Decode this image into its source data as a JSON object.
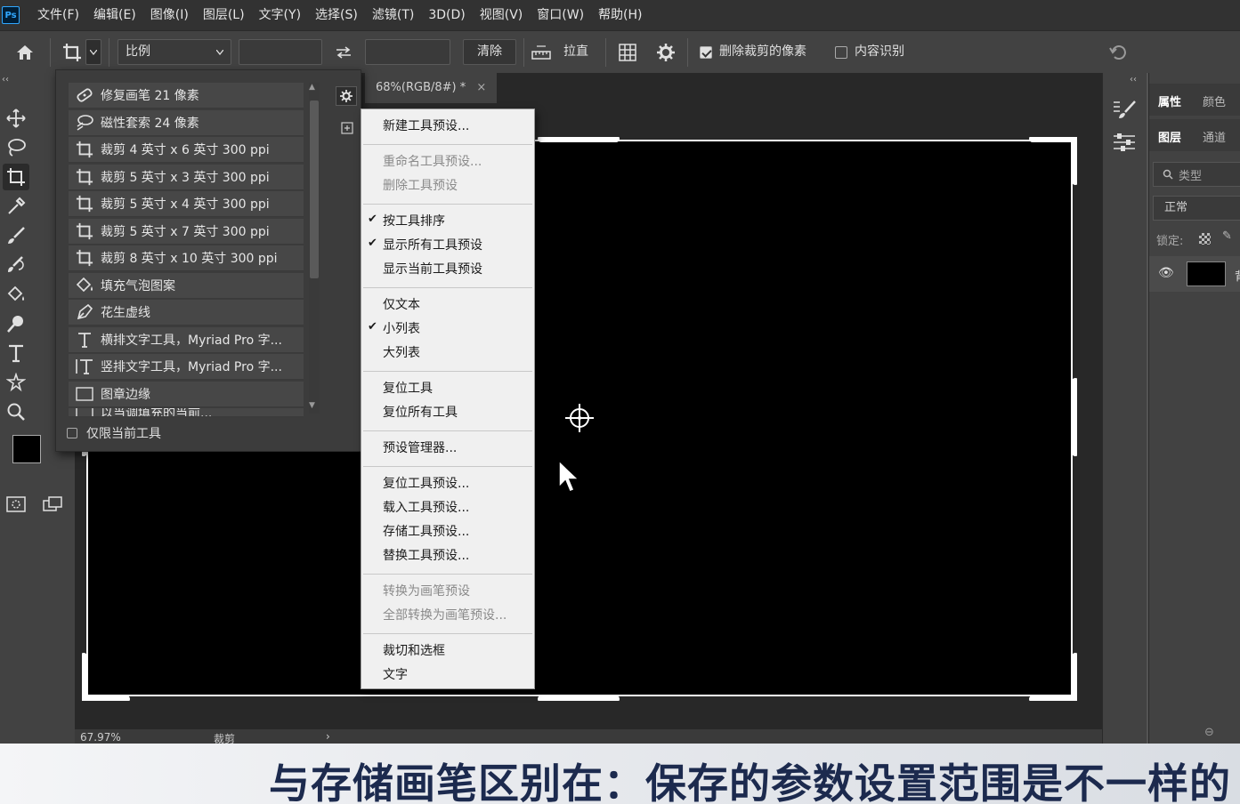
{
  "menubar": {
    "logo": "Ps",
    "items": [
      "文件(F)",
      "编辑(E)",
      "图像(I)",
      "图层(L)",
      "文字(Y)",
      "选择(S)",
      "滤镜(T)",
      "3D(D)",
      "视图(V)",
      "窗口(W)",
      "帮助(H)"
    ]
  },
  "options": {
    "ratio_select": "比例",
    "clear_button": "清除",
    "straighten": "拉直",
    "delete_cropped": {
      "label": "删除裁剪的像素",
      "checked": true
    },
    "content_aware": {
      "label": "内容识别",
      "checked": false
    }
  },
  "document": {
    "tab_title": "68%(RGB/8#) *",
    "zoom": "67.97%",
    "status": "裁剪"
  },
  "presets_panel": {
    "items": [
      {
        "icon": "healing-brush-icon",
        "label": "修复画笔 21 像素"
      },
      {
        "icon": "magnetic-lasso-icon",
        "label": "磁性套索 24 像素"
      },
      {
        "icon": "crop-icon",
        "label": "裁剪 4 英寸 x 6 英寸 300 ppi"
      },
      {
        "icon": "crop-icon",
        "label": "裁剪 5 英寸 x 3 英寸 300 ppi"
      },
      {
        "icon": "crop-icon",
        "label": "裁剪 5 英寸 x 4 英寸 300 ppi"
      },
      {
        "icon": "crop-icon",
        "label": "裁剪 5 英寸 x 7 英寸 300 ppi"
      },
      {
        "icon": "crop-icon",
        "label": "裁剪 8 英寸 x 10 英寸 300 ppi"
      },
      {
        "icon": "paint-bucket-icon",
        "label": "填充气泡图案"
      },
      {
        "icon": "pen-icon",
        "label": "花生虚线"
      },
      {
        "icon": "horizontal-type-icon",
        "label": "横排文字工具，Myriad Pro 字..."
      },
      {
        "icon": "vertical-type-icon",
        "label": "竖排文字工具，Myriad Pro 字..."
      },
      {
        "icon": "rectangle-icon",
        "label": "图章边缘"
      },
      {
        "icon": "rectangle-icon",
        "label": "以当调填充的当前..."
      }
    ],
    "current_tool_only": "仅限当前工具"
  },
  "context_menu": {
    "groups": [
      [
        {
          "label": "新建工具预设...",
          "enabled": true,
          "checked": false
        }
      ],
      [
        {
          "label": "重命名工具预设...",
          "enabled": false,
          "checked": false
        },
        {
          "label": "删除工具预设",
          "enabled": false,
          "checked": false
        }
      ],
      [
        {
          "label": "按工具排序",
          "enabled": true,
          "checked": true
        },
        {
          "label": "显示所有工具预设",
          "enabled": true,
          "checked": true
        },
        {
          "label": "显示当前工具预设",
          "enabled": true,
          "checked": false
        }
      ],
      [
        {
          "label": "仅文本",
          "enabled": true,
          "checked": false
        },
        {
          "label": "小列表",
          "enabled": true,
          "checked": true
        },
        {
          "label": "大列表",
          "enabled": true,
          "checked": false
        }
      ],
      [
        {
          "label": "复位工具",
          "enabled": true,
          "checked": false
        },
        {
          "label": "复位所有工具",
          "enabled": true,
          "checked": false
        }
      ],
      [
        {
          "label": "预设管理器...",
          "enabled": true,
          "checked": false
        }
      ],
      [
        {
          "label": "复位工具预设...",
          "enabled": true,
          "checked": false
        },
        {
          "label": "载入工具预设...",
          "enabled": true,
          "checked": false
        },
        {
          "label": "存储工具预设...",
          "enabled": true,
          "checked": false
        },
        {
          "label": "替换工具预设...",
          "enabled": true,
          "checked": false
        }
      ],
      [
        {
          "label": "转换为画笔预设",
          "enabled": false,
          "checked": false
        },
        {
          "label": "全部转换为画笔预设...",
          "enabled": false,
          "checked": false
        }
      ],
      [
        {
          "label": "裁切和选框",
          "enabled": true,
          "checked": false
        },
        {
          "label": "文字",
          "enabled": true,
          "checked": false
        }
      ]
    ]
  },
  "right_panel": {
    "tabs_top": [
      "属性",
      "颜色"
    ],
    "tabs_mid": [
      "图层",
      "通道"
    ],
    "search_placeholder": "类型",
    "blend_mode": "正常",
    "lock_label": "锁定:",
    "layer_name_partial": "背"
  },
  "subtitle": "与存储画笔区别在：保存的参数设置范围是不一样的"
}
